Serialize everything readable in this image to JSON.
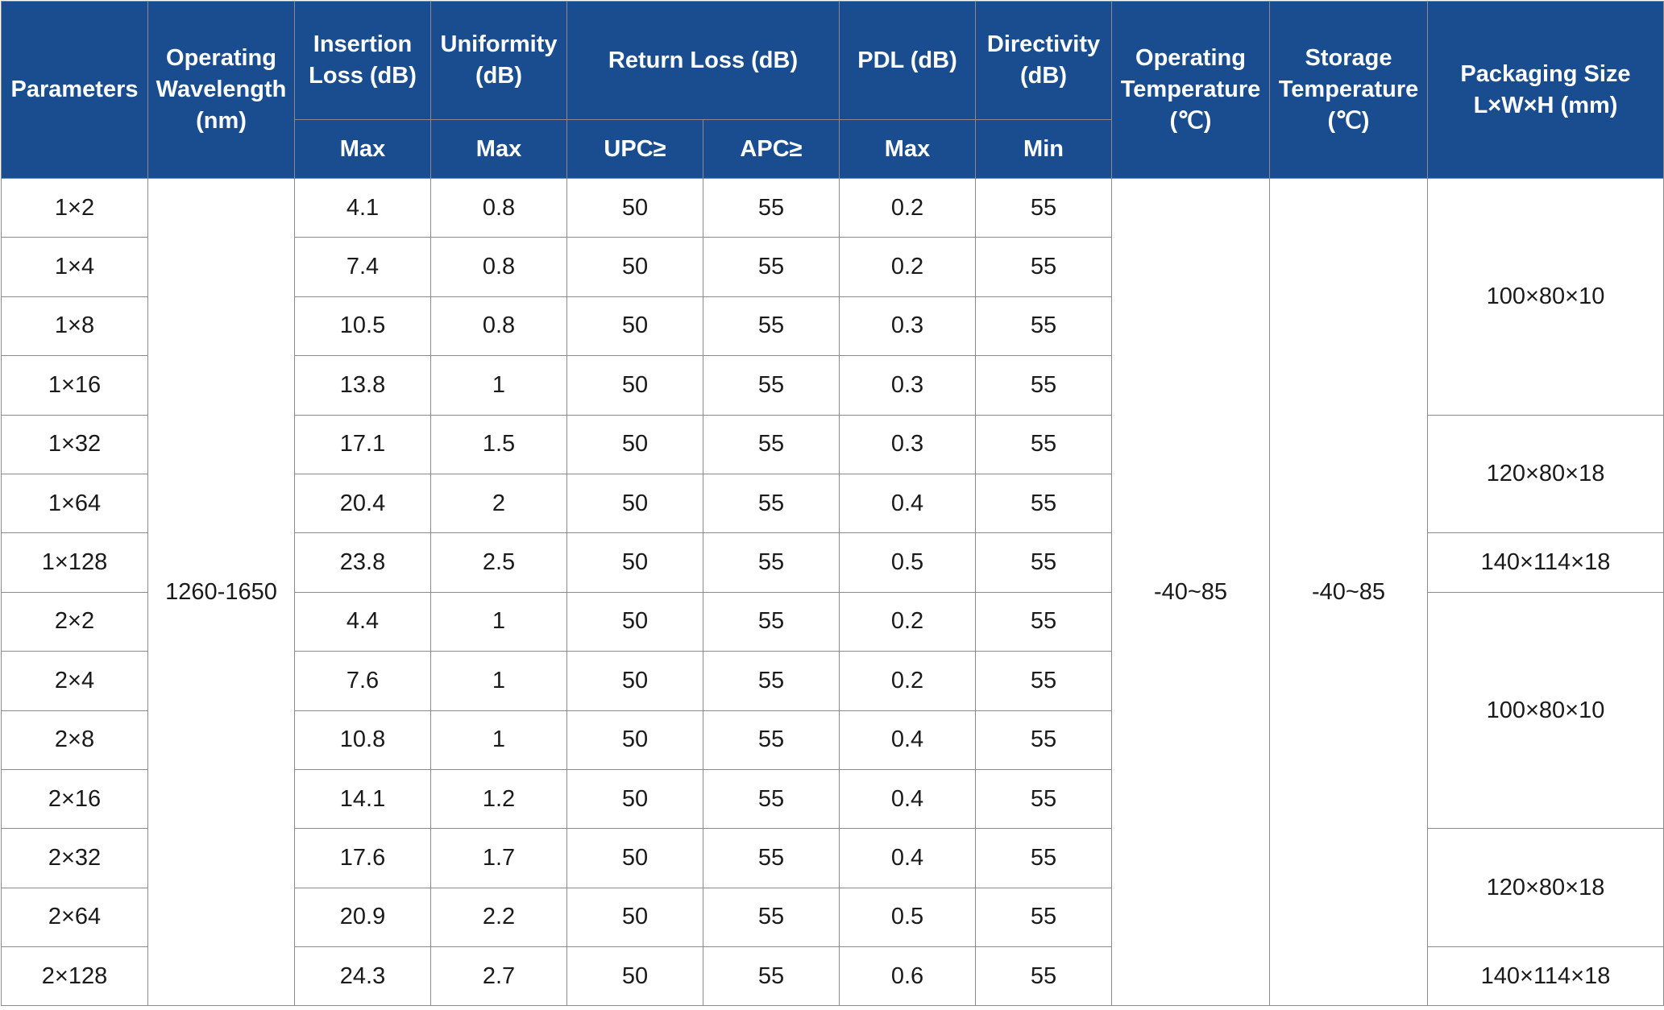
{
  "header": {
    "parameters": "Parameters",
    "wavelength": "Operating Wavelength (nm)",
    "insertion_loss": "Insertion Loss (dB)",
    "uniformity": "Uniformity (dB)",
    "return_loss": "Return Loss (dB)",
    "pdl": "PDL (dB)",
    "directivity": "Directivity (dB)",
    "operating_temp": "Operating Temperature (℃)",
    "storage_temp": "Storage Temperature (℃)",
    "packaging_size": "Packaging Size L×W×H (mm)",
    "sub": {
      "insertion_loss": "Max",
      "uniformity": "Max",
      "upc": "UPC≥",
      "apc": "APC≥",
      "pdl": "Max",
      "directivity": "Min"
    }
  },
  "rows": [
    {
      "param": "1×2",
      "il": "4.1",
      "uni": "0.8",
      "upc": "50",
      "apc": "55",
      "pdl": "0.2",
      "dir": "55"
    },
    {
      "param": "1×4",
      "il": "7.4",
      "uni": "0.8",
      "upc": "50",
      "apc": "55",
      "pdl": "0.2",
      "dir": "55"
    },
    {
      "param": "1×8",
      "il": "10.5",
      "uni": "0.8",
      "upc": "50",
      "apc": "55",
      "pdl": "0.3",
      "dir": "55"
    },
    {
      "param": "1×16",
      "il": "13.8",
      "uni": "1",
      "upc": "50",
      "apc": "55",
      "pdl": "0.3",
      "dir": "55"
    },
    {
      "param": "1×32",
      "il": "17.1",
      "uni": "1.5",
      "upc": "50",
      "apc": "55",
      "pdl": "0.3",
      "dir": "55"
    },
    {
      "param": "1×64",
      "il": "20.4",
      "uni": "2",
      "upc": "50",
      "apc": "55",
      "pdl": "0.4",
      "dir": "55"
    },
    {
      "param": "1×128",
      "il": "23.8",
      "uni": "2.5",
      "upc": "50",
      "apc": "55",
      "pdl": "0.5",
      "dir": "55"
    },
    {
      "param": "2×2",
      "il": "4.4",
      "uni": "1",
      "upc": "50",
      "apc": "55",
      "pdl": "0.2",
      "dir": "55"
    },
    {
      "param": "2×4",
      "il": "7.6",
      "uni": "1",
      "upc": "50",
      "apc": "55",
      "pdl": "0.2",
      "dir": "55"
    },
    {
      "param": "2×8",
      "il": "10.8",
      "uni": "1",
      "upc": "50",
      "apc": "55",
      "pdl": "0.4",
      "dir": "55"
    },
    {
      "param": "2×16",
      "il": "14.1",
      "uni": "1.2",
      "upc": "50",
      "apc": "55",
      "pdl": "0.4",
      "dir": "55"
    },
    {
      "param": "2×32",
      "il": "17.6",
      "uni": "1.7",
      "upc": "50",
      "apc": "55",
      "pdl": "0.4",
      "dir": "55"
    },
    {
      "param": "2×64",
      "il": "20.9",
      "uni": "2.2",
      "upc": "50",
      "apc": "55",
      "pdl": "0.5",
      "dir": "55"
    },
    {
      "param": "2×128",
      "il": "24.3",
      "uni": "2.7",
      "upc": "50",
      "apc": "55",
      "pdl": "0.6",
      "dir": "55"
    }
  ],
  "merged": {
    "wavelength": "1260-1650",
    "operating_temp": "-40~85",
    "storage_temp": "-40~85",
    "packaging": [
      {
        "value": "100×80×10",
        "rows": 4
      },
      {
        "value": "120×80×18",
        "rows": 2
      },
      {
        "value": "140×114×18",
        "rows": 1
      },
      {
        "value": "100×80×10",
        "rows": 4
      },
      {
        "value": "120×80×18",
        "rows": 2
      },
      {
        "value": "140×114×18",
        "rows": 1
      }
    ]
  },
  "colors": {
    "header_bg": "#1a4d8f",
    "header_text": "#ffffff",
    "border": "#8a8a8a",
    "cell_text": "#1a1a1a"
  }
}
